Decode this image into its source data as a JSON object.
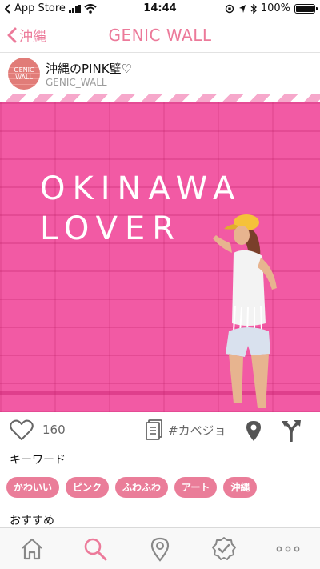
{
  "status_bar": {
    "carrier_back": "App Store",
    "time": "14:44",
    "battery": "100%"
  },
  "nav": {
    "back_label": "沖縄",
    "title": "GENIC WALL"
  },
  "post": {
    "avatar_line1": "GENIC",
    "avatar_line2": "WALL",
    "title": "沖縄のPINK壁♡",
    "subtitle": "GENIC_WALL"
  },
  "hero": {
    "line1": "OKINAWA",
    "line2": "LOVER"
  },
  "actions": {
    "like_count": "160",
    "note_label": "#カベジョ"
  },
  "keywords": {
    "label": "キーワード",
    "tags": [
      "かわいい",
      "ピンク",
      "ふわふわ",
      "アート",
      "沖縄"
    ]
  },
  "recommend": {
    "label": "おすすめ"
  },
  "colors": {
    "accent": "#ec7a9a",
    "tag_bg": "#ea7d99",
    "wall_pink": "#f25aa4"
  },
  "tab_bar": {
    "items": [
      "home-icon",
      "search-icon",
      "location-icon",
      "check-badge-icon",
      "more-icon"
    ],
    "active": "search-icon"
  }
}
